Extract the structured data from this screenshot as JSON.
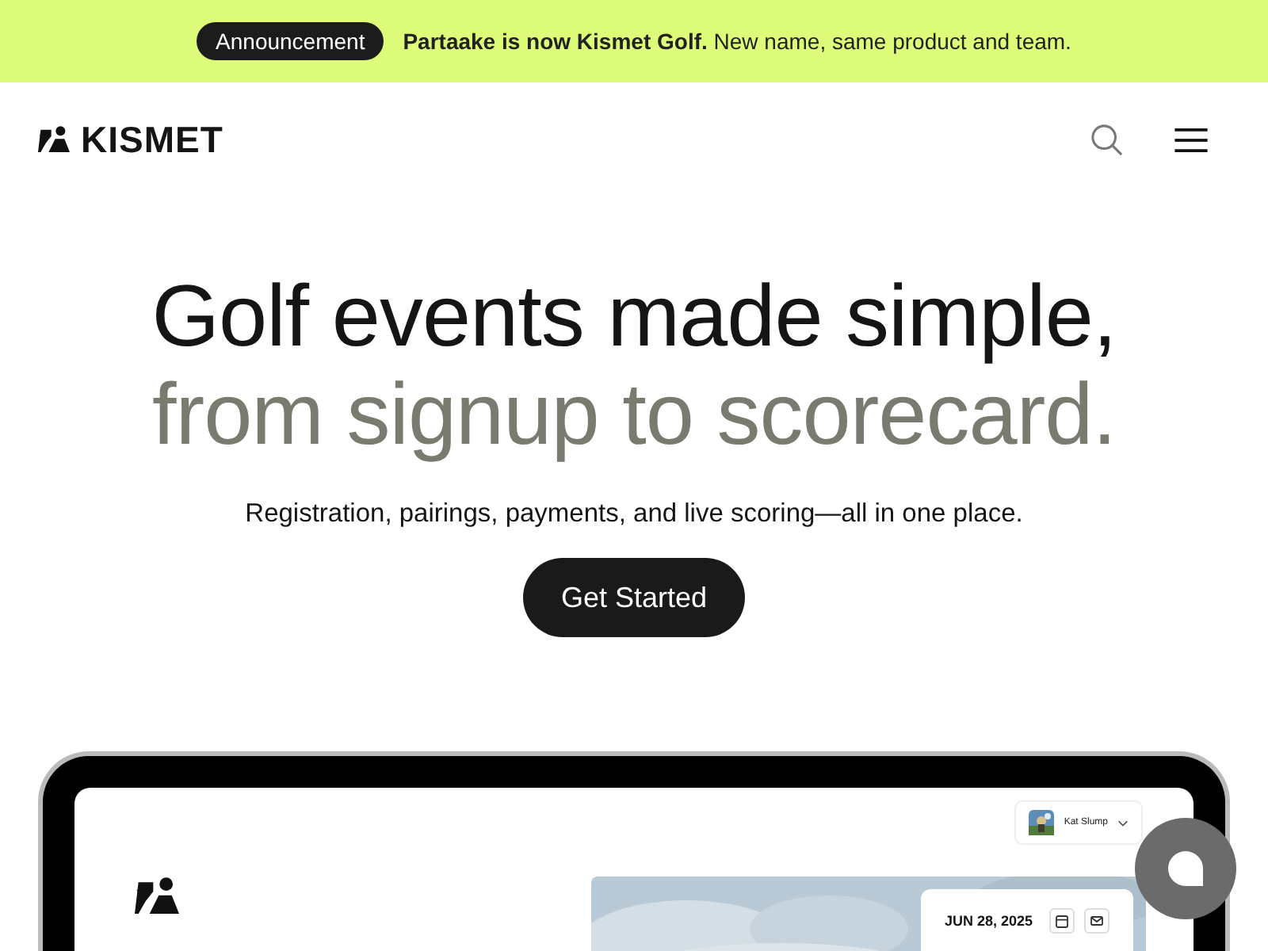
{
  "announcement": {
    "badge": "Announcement",
    "message": "**Partaake is now Kismet Golf.** New name, same product and team."
  },
  "header": {
    "brand": "KISMET"
  },
  "hero": {
    "title_line_1": "Golf events made simple,",
    "title_line_2": "from signup to scorecard.",
    "subtitle": "Registration, pairings, payments, and live scoring—all in one place.",
    "cta": "Get Started"
  },
  "preview": {
    "user_name": "Kat Slump",
    "event_date": "JUN 28, 2025"
  }
}
